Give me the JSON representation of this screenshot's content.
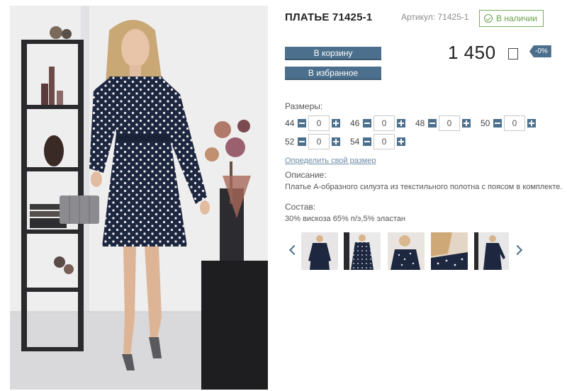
{
  "product": {
    "title": "ПЛАТЬЕ 71425-1",
    "sku_label": "Артикул: 71425-1",
    "stock_status": "В наличии",
    "price": "1 450",
    "discount": "-0%"
  },
  "actions": {
    "cart_label": "В корзину",
    "favorites_label": "В избранное"
  },
  "sizes": {
    "label": "Размеры:",
    "items": [
      {
        "size": "44",
        "qty": "0"
      },
      {
        "size": "46",
        "qty": "0"
      },
      {
        "size": "48",
        "qty": "0"
      },
      {
        "size": "50",
        "qty": "0"
      },
      {
        "size": "52",
        "qty": "0"
      },
      {
        "size": "54",
        "qty": "0"
      }
    ],
    "size_help_link": "Определить свой размер"
  },
  "description": {
    "label": "Описание:",
    "text": "Платье А-образного силуэта из текстильного полотна с поясом в комплекте."
  },
  "composition": {
    "label": "Состав:",
    "text": "30% вискоза 65% п/э,5% эластан"
  },
  "colors": {
    "accent": "#4b6f8c",
    "stock_green": "#6aa04a",
    "dress_navy": "#1e2740"
  },
  "icons": {
    "stock": "check-circle-icon",
    "currency": "ruble-icon",
    "prev": "chevron-left-icon",
    "next": "chevron-right-icon",
    "decrement": "minus-icon",
    "increment": "plus-icon"
  },
  "gallery": {
    "thumbnail_count": 5
  }
}
